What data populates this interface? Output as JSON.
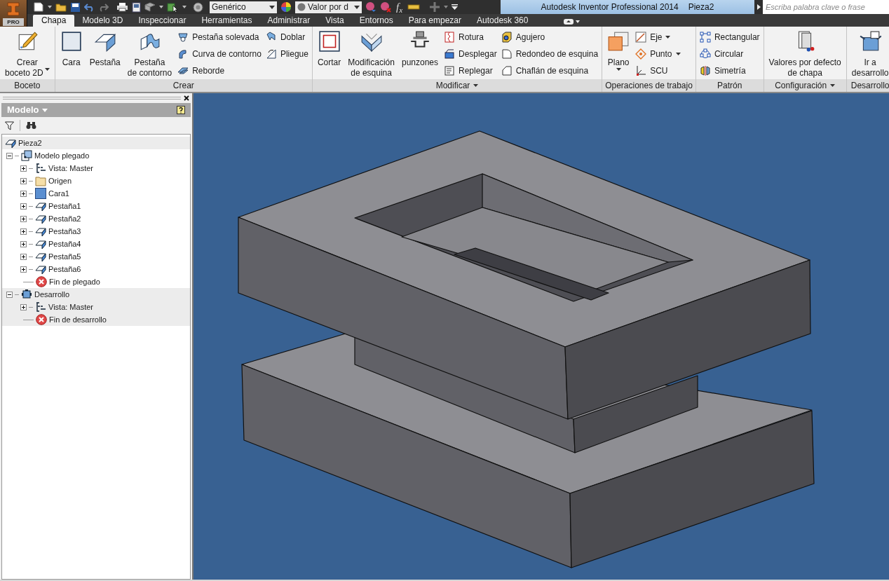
{
  "app_button": {
    "label": "PRO"
  },
  "quick_access": {
    "style_dropdown": "Genérico",
    "material_dropdown": "Valor por d",
    "parameters_label": "f$_{x}$"
  },
  "title_bar": {
    "title": "Autodesk Inventor Professional 2014",
    "document": "Pieza2"
  },
  "search": {
    "placeholder": "Escriba palabra clave o frase"
  },
  "tabs": [
    {
      "label": "Chapa",
      "selected": true
    },
    {
      "label": "Modelo 3D",
      "selected": false
    },
    {
      "label": "Inspeccionar",
      "selected": false
    },
    {
      "label": "Herramientas",
      "selected": false
    },
    {
      "label": "Administrar",
      "selected": false
    },
    {
      "label": "Vista",
      "selected": false
    },
    {
      "label": "Entornos",
      "selected": false
    },
    {
      "label": "Para empezar",
      "selected": false
    },
    {
      "label": "Autodesk 360",
      "selected": false
    }
  ],
  "panels": [
    {
      "title": "Boceto",
      "menu": false,
      "columns": [
        {
          "kind": "large",
          "lines": [
            "Crear",
            "boceto 2D"
          ],
          "dropdown": true
        }
      ]
    },
    {
      "title": "Crear",
      "menu": false,
      "columns": [
        {
          "kind": "large",
          "lines": [
            "Cara"
          ],
          "dropdown": false
        },
        {
          "kind": "large",
          "lines": [
            "Pestaña"
          ],
          "dropdown": false
        },
        {
          "kind": "large",
          "lines": [
            "Pestaña",
            "de contorno"
          ],
          "dropdown": false
        },
        {
          "kind": "stack",
          "items": [
            {
              "label": "Pestaña solevada",
              "dropdown": false
            },
            {
              "label": "Curva de contorno",
              "dropdown": false
            },
            {
              "label": "Reborde",
              "dropdown": false
            }
          ]
        },
        {
          "kind": "stack",
          "items": [
            {
              "label": "Doblar",
              "dropdown": false
            },
            {
              "label": "Pliegue",
              "dropdown": false
            }
          ]
        }
      ]
    },
    {
      "title": "Modificar",
      "menu": true,
      "columns": [
        {
          "kind": "large",
          "lines": [
            "Cortar"
          ],
          "dropdown": false
        },
        {
          "kind": "large",
          "lines": [
            "Modificación",
            "de esquina"
          ],
          "dropdown": false
        },
        {
          "kind": "large",
          "lines": [
            "punzones"
          ],
          "dropdown": false
        },
        {
          "kind": "stack",
          "items": [
            {
              "label": "Rotura",
              "dropdown": false
            },
            {
              "label": "Desplegar",
              "dropdown": false
            },
            {
              "label": "Replegar",
              "dropdown": false
            }
          ]
        },
        {
          "kind": "stack",
          "items": [
            {
              "label": "Agujero",
              "dropdown": false
            },
            {
              "label": "Redondeo de esquina",
              "dropdown": false
            },
            {
              "label": "Chaflán de esquina",
              "dropdown": false
            }
          ]
        }
      ]
    },
    {
      "title": "Operaciones de trabajo",
      "menu": false,
      "columns": [
        {
          "kind": "large",
          "lines": [
            "Plano"
          ],
          "dropdown": true
        },
        {
          "kind": "stack",
          "items": [
            {
              "label": "Eje",
              "dropdown": true
            },
            {
              "label": "Punto",
              "dropdown": true
            },
            {
              "label": "SCU",
              "dropdown": false
            }
          ]
        }
      ]
    },
    {
      "title": "Patrón",
      "menu": false,
      "columns": [
        {
          "kind": "stack",
          "items": [
            {
              "label": "Rectangular",
              "dropdown": false
            },
            {
              "label": "Circular",
              "dropdown": false
            },
            {
              "label": "Simetría",
              "dropdown": false
            }
          ]
        }
      ]
    },
    {
      "title": "Configuración",
      "menu": true,
      "columns": [
        {
          "kind": "large",
          "lines": [
            "Valores por defecto",
            "de chapa"
          ],
          "dropdown": false
        }
      ]
    },
    {
      "title": "Desarrollo",
      "menu": false,
      "columns": [
        {
          "kind": "large",
          "lines": [
            "Ir a",
            "desarrollo"
          ],
          "dropdown": false
        }
      ]
    }
  ],
  "browser": {
    "title": "Modelo",
    "tree": [
      {
        "label": "Pieza2",
        "kind": "part",
        "children": [
          {
            "label": "Modelo plegado",
            "kind": "folded",
            "expanded": true,
            "active": true,
            "children": [
              {
                "label": "Vista: Master",
                "kind": "view",
                "expanded": false
              },
              {
                "label": "Origen",
                "kind": "folder",
                "expanded": false
              },
              {
                "label": "Cara1",
                "kind": "face",
                "expanded": false
              },
              {
                "label": "Pestaña1",
                "kind": "flange",
                "expanded": false
              },
              {
                "label": "Pestaña2",
                "kind": "flange",
                "expanded": false
              },
              {
                "label": "Pestaña3",
                "kind": "flange",
                "expanded": false
              },
              {
                "label": "Pestaña4",
                "kind": "flange",
                "expanded": false
              },
              {
                "label": "Pestaña5",
                "kind": "flange",
                "expanded": false
              },
              {
                "label": "Pestaña6",
                "kind": "flange",
                "expanded": false
              },
              {
                "label": "Fin de plegado",
                "kind": "end"
              }
            ]
          },
          {
            "label": "Desarrollo",
            "kind": "flat",
            "expanded": true,
            "active": false,
            "children": [
              {
                "label": "Vista: Master",
                "kind": "view",
                "expanded": false
              },
              {
                "label": "Fin de desarrollo",
                "kind": "end"
              }
            ]
          }
        ]
      }
    ]
  }
}
